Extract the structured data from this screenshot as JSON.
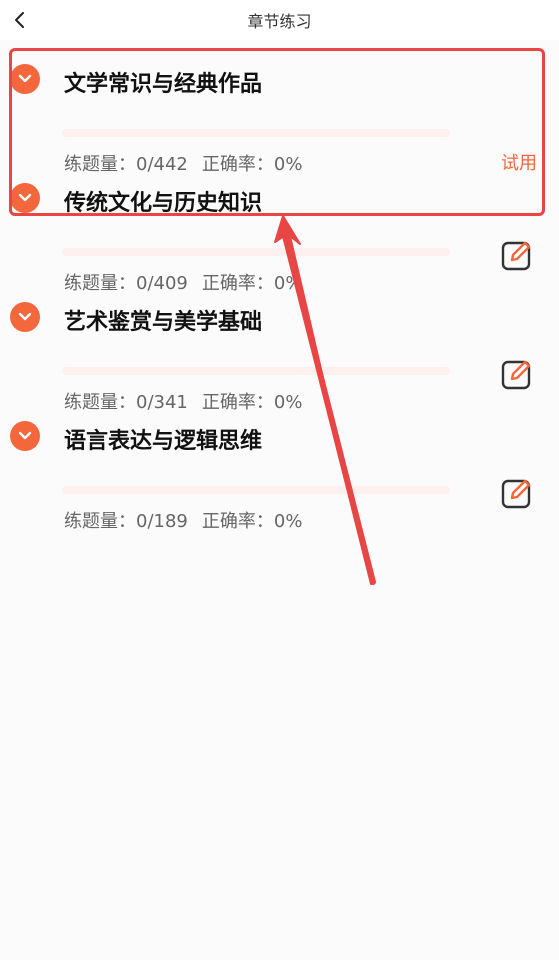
{
  "header": {
    "title": "章节练习",
    "back_icon": "chevron-left-icon"
  },
  "colors": {
    "accent": "#f4663c",
    "highlight": "#e84545",
    "progress_track": "#fff0f0"
  },
  "chapters": [
    {
      "title": "文学常识与经典作品",
      "count_label": "练题量：",
      "count_value": "0/442",
      "rate_label": "正确率：",
      "rate_value": "0%",
      "progress": 0,
      "action": "试用"
    },
    {
      "title": "传统文化与历史知识",
      "count_label": "练题量：",
      "count_value": "0/409",
      "rate_label": "正确率：",
      "rate_value": "0%",
      "progress": 0,
      "action_icon": "edit-icon"
    },
    {
      "title": "艺术鉴赏与美学基础",
      "count_label": "练题量：",
      "count_value": "0/341",
      "rate_label": "正确率：",
      "rate_value": "0%",
      "progress": 0,
      "action_icon": "edit-icon"
    },
    {
      "title": "语言表达与逻辑思维",
      "count_label": "练题量：",
      "count_value": "0/189",
      "rate_label": "正确率：",
      "rate_value": "0%",
      "progress": 0,
      "action_icon": "edit-icon"
    }
  ]
}
